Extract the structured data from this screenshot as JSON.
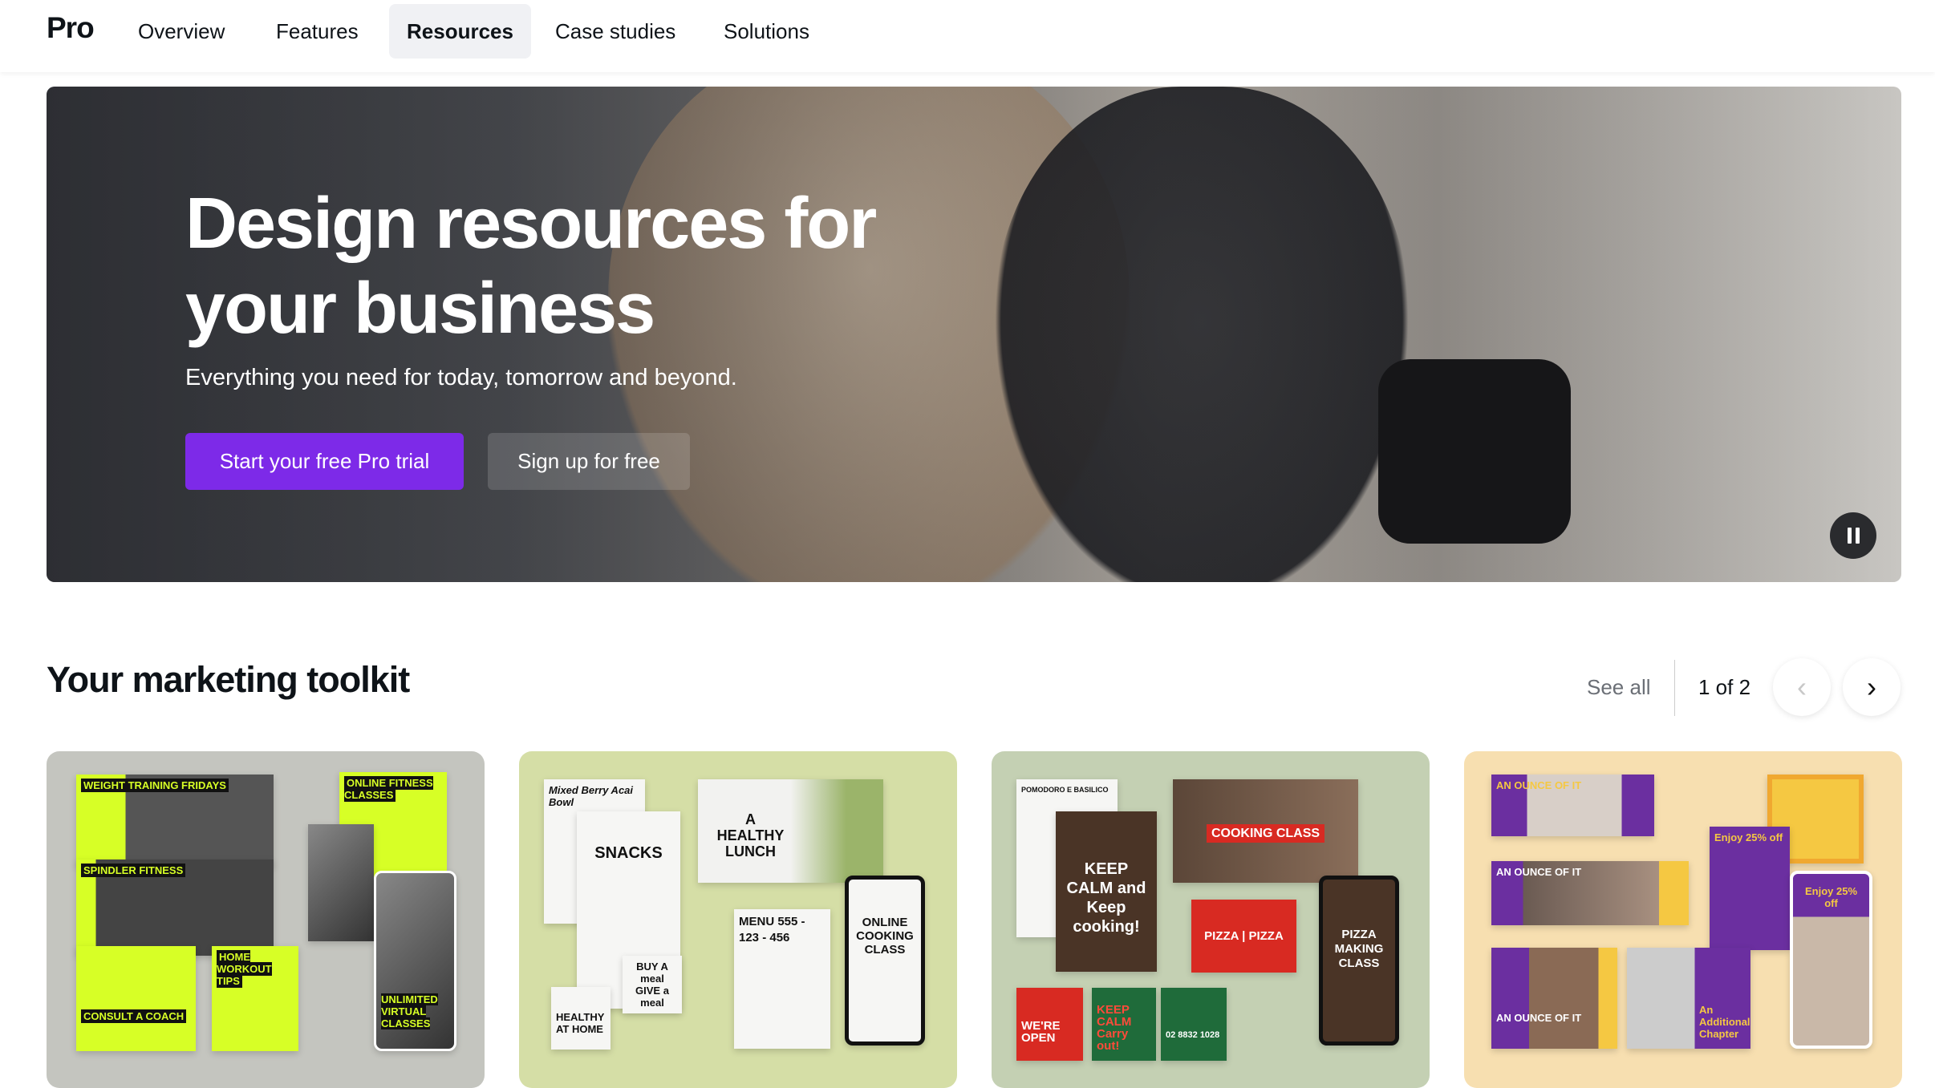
{
  "nav": {
    "logo": "Pro",
    "items": [
      {
        "label": "Overview"
      },
      {
        "label": "Features"
      },
      {
        "label": "Resources",
        "active": true
      },
      {
        "label": "Case studies"
      },
      {
        "label": "Solutions"
      }
    ]
  },
  "hero": {
    "title": "Design resources for your business",
    "subtitle": "Everything you need for today, tomorrow and beyond.",
    "primary_button": "Start your free Pro trial",
    "secondary_button": "Sign up for free",
    "pause_icon": "pause-icon"
  },
  "toolkit": {
    "title": "Your marketing toolkit",
    "see_all": "See all",
    "pager": "1 of 2",
    "prev_icon": "chevron-left-icon",
    "next_icon": "chevron-right-icon",
    "cards": [
      {
        "bg": "#c4c5bf",
        "tiles": [
          "WEIGHT TRAINING FRIDAYS",
          "ONLINE FITNESS CLASSES",
          "",
          "SPINDLER FITNESS",
          "UNLIMITED VIRTUAL CLASSES",
          "CONSULT A COACH",
          "HOME WORKOUT TIPS"
        ]
      },
      {
        "bg": "#d5dea6",
        "tiles": [
          "Mixed Berry Acai Bowl",
          "SNACKS",
          "A HEALTHY LUNCH",
          "BUY A meal GIVE a meal",
          "HEALTHY AT HOME",
          "MENU 555 - 123 - 456",
          "ONLINE COOKING CLASS"
        ]
      },
      {
        "bg": "#c4d0b3",
        "tiles": [
          "POMODORO E BASILICO",
          "KEEP CALM and Keep cooking!",
          "COOKING CLASS",
          "PIZZA | PIZZA",
          "WE'RE OPEN",
          "KEEP CALM Carry out!",
          "02 8832 1028",
          "PIZZA MAKING CLASS"
        ]
      },
      {
        "bg": "#f7dfb0",
        "tiles": [
          "AN OUNCE OF IT",
          "Enjoy 25% off",
          "AN OUNCE OF IT",
          "",
          "AN OUNCE OF IT",
          "An Additional Chapter",
          "Enjoy 25% off"
        ]
      }
    ]
  },
  "colors": {
    "accent": "#7d2ae8",
    "lime": "#d7ff26",
    "purple": "#6b2fa0"
  }
}
